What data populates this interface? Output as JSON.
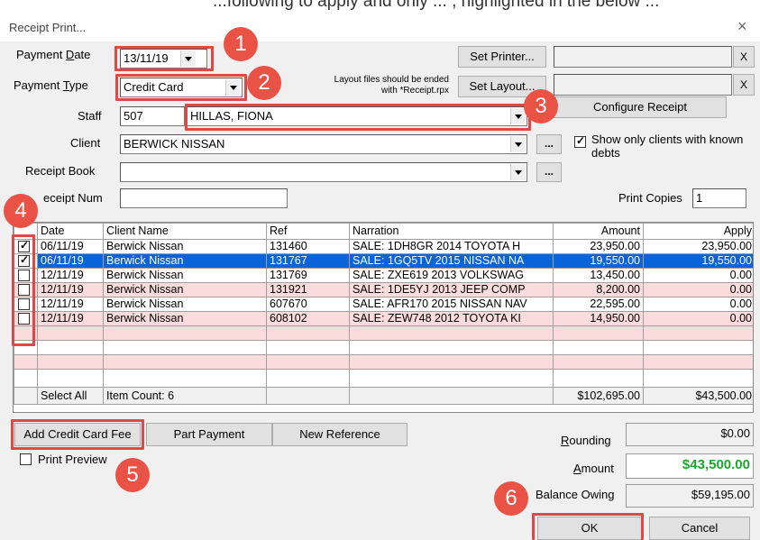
{
  "top_strip": "...following to apply and only ... , highlighted in the below ...",
  "window": {
    "title": "Receipt Print...",
    "close": "×"
  },
  "form": {
    "payment_date": {
      "label_pre": "Payment ",
      "label_u": "D",
      "label_post": "ate",
      "value": "13/11/19"
    },
    "payment_type": {
      "label_pre": "Payment ",
      "label_u": "T",
      "label_post": "ype",
      "value": "Credit Card"
    },
    "staff": {
      "label": "Staff",
      "code": "507",
      "name": "HILLAS, FIONA"
    },
    "client": {
      "label": "Client",
      "value": "BERWICK NISSAN"
    },
    "receipt_book": {
      "label": "Receipt Book",
      "value": ""
    },
    "receipt_num": {
      "label": "eceipt Num",
      "value": ""
    },
    "show_only_debts": {
      "label": "Show only clients with known debts",
      "checked": true
    },
    "print_copies": {
      "label": "Print Copies",
      "value": "1"
    }
  },
  "printer": {
    "set_printer_label": "Set Printer...",
    "set_layout_label": "Set Layout...",
    "layout_note_1": "Layout files should be ended",
    "layout_note_2": "with *Receipt.rpx",
    "configure_label": "Configure Receipt",
    "clear_label": "X",
    "ellipsis": "..."
  },
  "table": {
    "headers": [
      "",
      "Date",
      "Client Name",
      "Ref",
      "Narration",
      "Amount",
      "Apply"
    ],
    "rows": [
      {
        "checked": true,
        "date": "06/11/19",
        "client": "Berwick Nissan",
        "ref": "131460",
        "narration": "SALE: 1DH8GR 2014 TOYOTA H",
        "amount": "23,950.00",
        "apply": "23,950.00",
        "style": "white"
      },
      {
        "checked": true,
        "date": "06/11/19",
        "client": "Berwick Nissan",
        "ref": "131767",
        "narration": "SALE: 1GQ5TV 2015 NISSAN NA",
        "amount": "19,550.00",
        "apply": "19,550.00",
        "style": "sel"
      },
      {
        "checked": false,
        "date": "12/11/19",
        "client": "Berwick Nissan",
        "ref": "131769",
        "narration": "SALE: ZXE619 2013 VOLKSWAG",
        "amount": "13,450.00",
        "apply": "0.00",
        "style": "white"
      },
      {
        "checked": false,
        "date": "12/11/19",
        "client": "Berwick Nissan",
        "ref": "131921",
        "narration": "SALE: 1DE5YJ 2013 JEEP COMP",
        "amount": "8,200.00",
        "apply": "0.00",
        "style": "pink"
      },
      {
        "checked": false,
        "date": "12/11/19",
        "client": "Berwick Nissan",
        "ref": "607670",
        "narration": "SALE: AFR170 2015 NISSAN NAV",
        "amount": "22,595.00",
        "apply": "0.00",
        "style": "white"
      },
      {
        "checked": false,
        "date": "12/11/19",
        "client": "Berwick Nissan",
        "ref": "608102",
        "narration": "SALE: ZEW748 2012 TOYOTA KI",
        "amount": "14,950.00",
        "apply": "0.00",
        "style": "pink"
      }
    ],
    "footer": {
      "select_all": "Select All",
      "item_count": "Item Count: 6",
      "amount_total": "$102,695.00",
      "apply_total": "$43,500.00"
    }
  },
  "buttons": {
    "add_cc_fee": "Add Credit Card Fee",
    "part_payment": "Part Payment",
    "new_reference": "New Reference",
    "ok": "OK",
    "cancel": "Cancel"
  },
  "print_preview": {
    "label": "Print Preview",
    "checked": false
  },
  "totals": {
    "rounding": {
      "label_u": "R",
      "label_post": "ounding",
      "value": "$0.00"
    },
    "amount": {
      "label_u": "A",
      "label_post": "mount",
      "value": "$43,500.00"
    },
    "balance": {
      "label": "Balance Owing",
      "value": "$59,195.00"
    }
  },
  "badges": [
    "1",
    "2",
    "3",
    "4",
    "5",
    "6"
  ],
  "colors": {
    "highlight": "#e04848",
    "badge": "#e95245",
    "selected_row": "#0a64d8",
    "pink_row": "#fbdcdc",
    "amount_green": "#1aa82a"
  }
}
